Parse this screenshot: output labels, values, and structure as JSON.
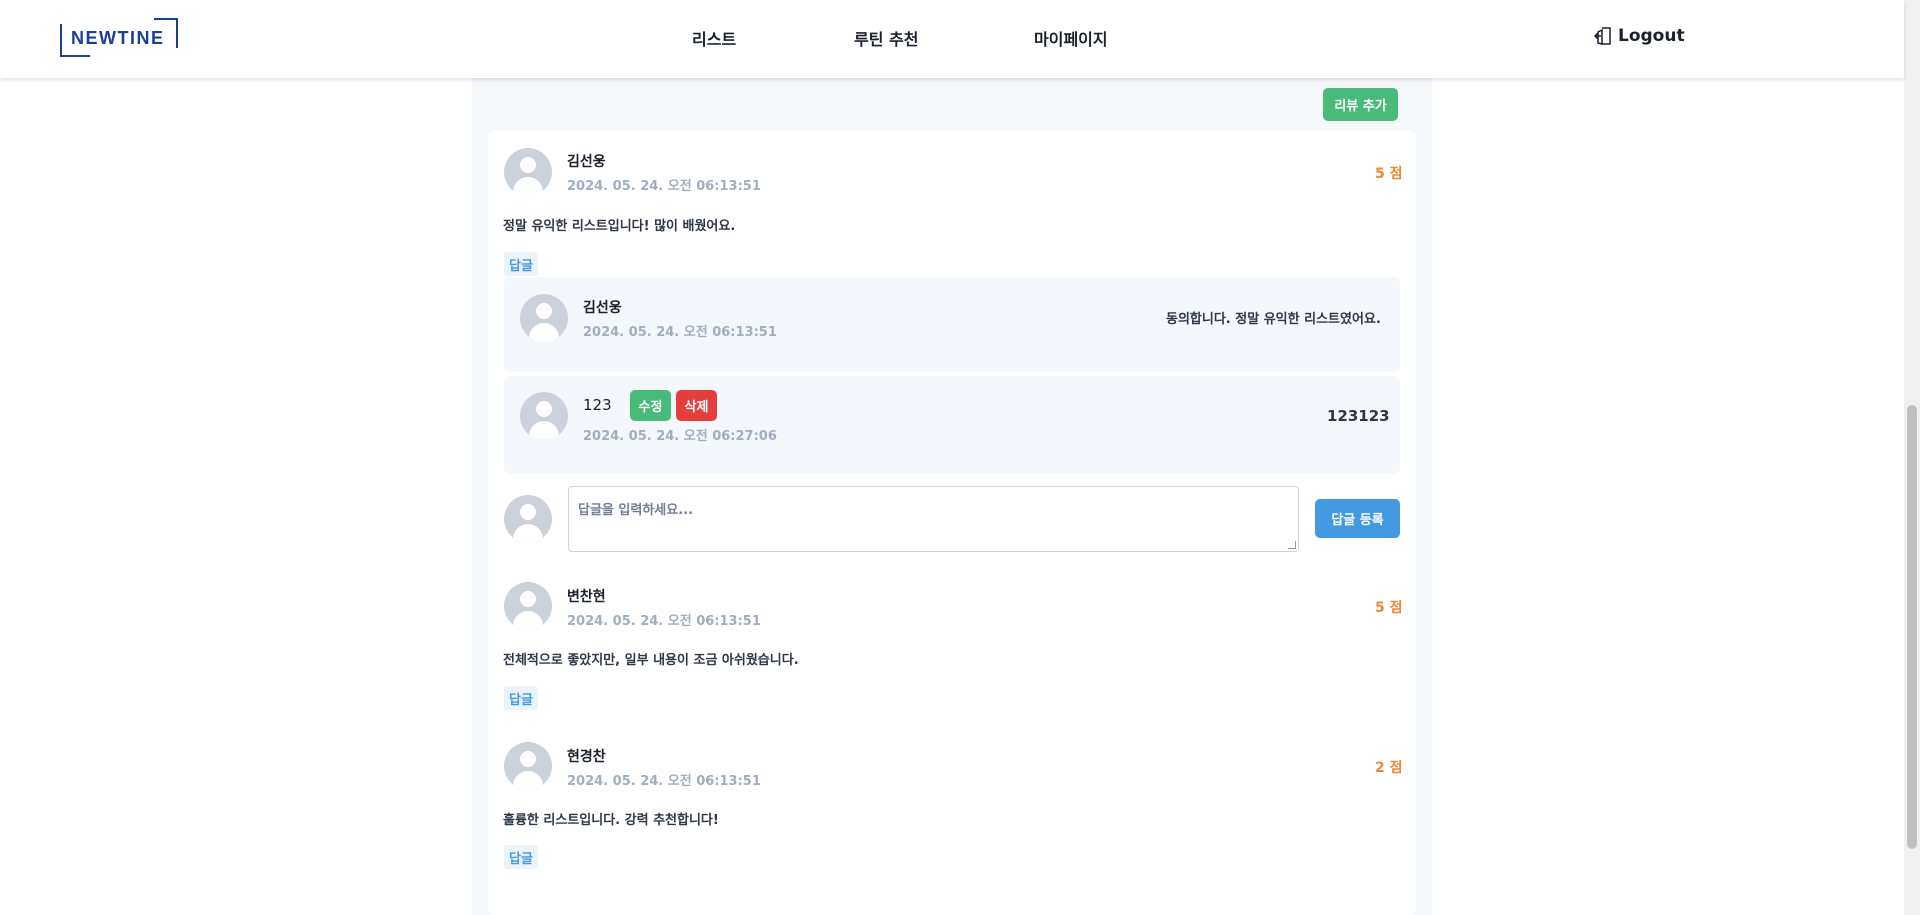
{
  "header": {
    "logo_text": "NEWTINE",
    "nav": [
      "리스트",
      "루틴 추천",
      "마이페이지"
    ],
    "logout_label": "Logout",
    "logout_icon": "logout-door-icon"
  },
  "actions": {
    "add_review_label": "리뷰 추가"
  },
  "reviews": [
    {
      "author": "김선웅",
      "date": "2024. 05. 24. 오전 06:13:51",
      "score": "5 점",
      "text": "정말 유익한 리스트입니다! 많이 배웠어요.",
      "reply_label": "답글",
      "replies": [
        {
          "author": "김선웅",
          "date": "2024. 05. 24. 오전 06:13:51",
          "text": "동의합니다. 정말 유익한 리스트였어요."
        },
        {
          "author": "123",
          "date": "2024. 05. 24. 오전 06:27:06",
          "text": "123123",
          "edit_label": "수정",
          "delete_label": "삭제"
        }
      ],
      "reply_input": {
        "placeholder": "답글을 입력하세요...",
        "submit_label": "답글 등록"
      }
    },
    {
      "author": "변찬현",
      "date": "2024. 05. 24. 오전 06:13:51",
      "score": "5 점",
      "text": "전체적으로 좋았지만, 일부 내용이 조금 아쉬웠습니다.",
      "reply_label": "답글"
    },
    {
      "author": "현경찬",
      "date": "2024. 05. 24. 오전 06:13:51",
      "score": "2 점",
      "text": "훌륭한 리스트입니다. 강력 추천합니다!",
      "reply_label": "답글"
    }
  ],
  "colors": {
    "brand": "#1c3f8f",
    "score": "#ed8936",
    "green_button": "#48bb78",
    "red_button": "#e53e3e",
    "blue_button": "#4299e1"
  }
}
